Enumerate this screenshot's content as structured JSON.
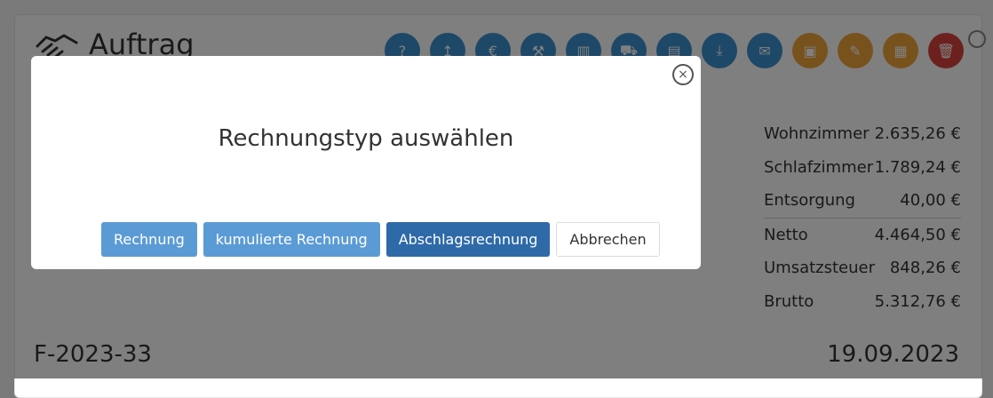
{
  "page": {
    "title": "Auftrag",
    "toolbar_icons": [
      {
        "name": "help-icon",
        "color": "blue",
        "glyph": "?"
      },
      {
        "name": "upload-icon",
        "color": "blue",
        "glyph": "↥"
      },
      {
        "name": "euro-icon",
        "color": "blue",
        "glyph": "€"
      },
      {
        "name": "hammer-icon",
        "color": "blue",
        "glyph": "⚒"
      },
      {
        "name": "ruler-icon",
        "color": "blue",
        "glyph": "▥"
      },
      {
        "name": "truck-icon",
        "color": "blue",
        "glyph": "⛟"
      },
      {
        "name": "pdf-icon",
        "color": "blue",
        "glyph": "▤"
      },
      {
        "name": "download-icon",
        "color": "blue",
        "glyph": "⤓"
      },
      {
        "name": "mail-icon",
        "color": "blue",
        "glyph": "✉"
      },
      {
        "name": "book-icon",
        "color": "orange",
        "glyph": "▣"
      },
      {
        "name": "edit-icon",
        "color": "orange",
        "glyph": "✎"
      },
      {
        "name": "document-icon",
        "color": "orange",
        "glyph": "▦"
      },
      {
        "name": "trash-icon",
        "color": "red",
        "glyph": "🗑"
      }
    ],
    "totals": [
      {
        "label": "Wohnzimmer",
        "value": "2.635,26 €"
      },
      {
        "label": "Schlafzimmer",
        "value": "1.789,24 €"
      },
      {
        "label": "Entsorgung",
        "value": "40,00 €"
      },
      {
        "label": "Netto",
        "value": "4.464,50 €"
      },
      {
        "label": "Umsatzsteuer",
        "value": "848,26 €"
      },
      {
        "label": "Brutto",
        "value": "5.312,76 €"
      }
    ],
    "invoice_number": "F-2023-33",
    "invoice_date": "19.09.2023"
  },
  "modal": {
    "title": "Rechnungstyp auswählen",
    "close_glyph": "×",
    "buttons": {
      "rechnung": "Rechnung",
      "kumuliert": "kumulierte Rechnung",
      "abschlag": "Abschlagsrechnung",
      "abbrechen": "Abbrechen"
    }
  },
  "colors": {
    "blue": "#3d91cf",
    "orange": "#f0a43a",
    "red": "#d9433d",
    "modal_btn_light": "#5b9bd5",
    "modal_btn_dark": "#2f6aa8"
  }
}
